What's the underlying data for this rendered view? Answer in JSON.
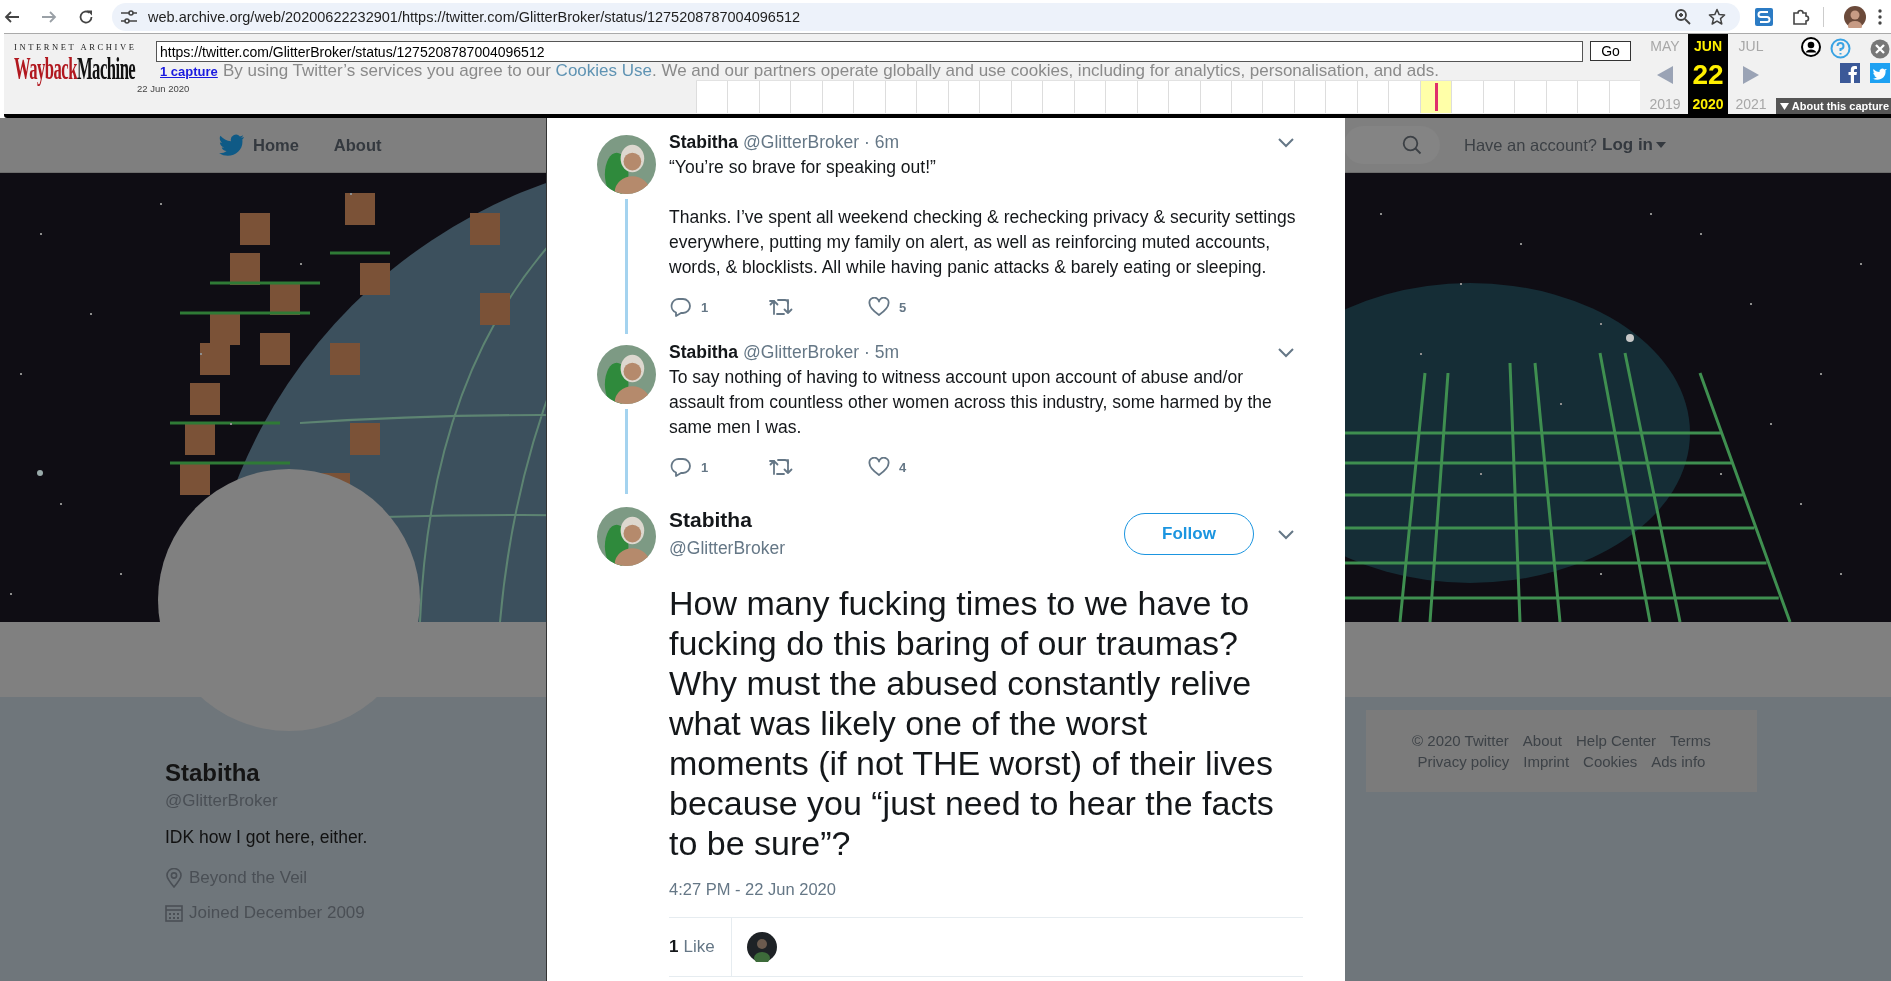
{
  "browser": {
    "url": "web.archive.org/web/20200622232901/https://twitter.com/GlitterBroker/status/1275208787004096512"
  },
  "wayback": {
    "logo_top": "INTERNET ARCHIVE",
    "logo_first": "Wayback",
    "logo_second": "Machine",
    "url": "https://twitter.com/GlitterBroker/status/1275208787004096512",
    "go": "Go",
    "captures": "1 capture",
    "capture_date": "22 Jun 2020",
    "timeline": [
      {
        "selected": false
      },
      {
        "selected": false
      },
      {
        "selected": false
      },
      {
        "selected": false
      },
      {
        "selected": false
      },
      {
        "selected": false
      },
      {
        "selected": false
      },
      {
        "selected": false
      },
      {
        "selected": false
      },
      {
        "selected": false
      },
      {
        "selected": false
      },
      {
        "selected": false
      },
      {
        "selected": false
      },
      {
        "selected": false
      },
      {
        "selected": false
      },
      {
        "selected": false
      },
      {
        "selected": false
      },
      {
        "selected": false
      },
      {
        "selected": false
      },
      {
        "selected": false
      },
      {
        "selected": false
      },
      {
        "selected": false
      },
      {
        "selected": false
      },
      {
        "selected": true
      },
      {
        "selected": false
      },
      {
        "selected": false
      },
      {
        "selected": false
      },
      {
        "selected": false
      },
      {
        "selected": false
      },
      {
        "selected": false
      }
    ],
    "months": [
      {
        "month": "MAY",
        "year": "2019",
        "selected": false
      },
      {
        "month": "JUN",
        "day": "22",
        "year": "2020",
        "selected": true
      },
      {
        "month": "JUL",
        "year": "2021",
        "selected": false
      }
    ],
    "about": "About this capture"
  },
  "cookie_notice": {
    "before": "By using Twitter’s services you agree to our",
    "link": "Cookies Use",
    "after": ". We and our partners operate globally and use cookies, including for analytics, personalisation, and ads."
  },
  "nav": {
    "links": [
      "Home",
      "About"
    ],
    "login_prompt": "Have an account?",
    "login": "Log in"
  },
  "profile": {
    "name": "Stabitha",
    "handle": "@GlitterBroker",
    "bio": "IDK how I got here, either.",
    "location": "Beyond the Veil",
    "joined": "Joined December 2009"
  },
  "footer": {
    "copyright": "© 2020 Twitter",
    "links": [
      "About",
      "Help Center",
      "Terms",
      "Privacy policy",
      "Imprint",
      "Cookies",
      "Ads info"
    ]
  },
  "thread": [
    {
      "name": "Stabitha",
      "handle": "@GlitterBroker",
      "time": "· 6m",
      "text": "“You’re so brave for speaking out!”\n\nThanks. I’ve spent all weekend checking & rechecking privacy & security settings everywhere, putting my family on alert, as well as reinforcing muted accounts, words, & blocklists. All while having panic attacks & barely eating or sleeping.",
      "replies": "1",
      "likes": "5"
    },
    {
      "name": "Stabitha",
      "handle": "@GlitterBroker",
      "time": "· 5m",
      "text": "To say nothing of having to witness account upon account of abuse and/or assault from countless other women across this industry, some harmed by the same men I was.",
      "replies": "1",
      "likes": "4"
    }
  ],
  "main_tweet": {
    "name": "Stabitha",
    "handle": "@GlitterBroker",
    "follow": "Follow",
    "text": "How many fucking times to we have to fucking do this baring of our traumas? Why must the abused constantly relive what was likely one of the worst moments (if not THE worst) of their lives because you “just need to hear the facts to be sure”?",
    "timestamp": "4:27 PM - 22 Jun 2020",
    "like_count": "1",
    "like_label": "Like"
  }
}
